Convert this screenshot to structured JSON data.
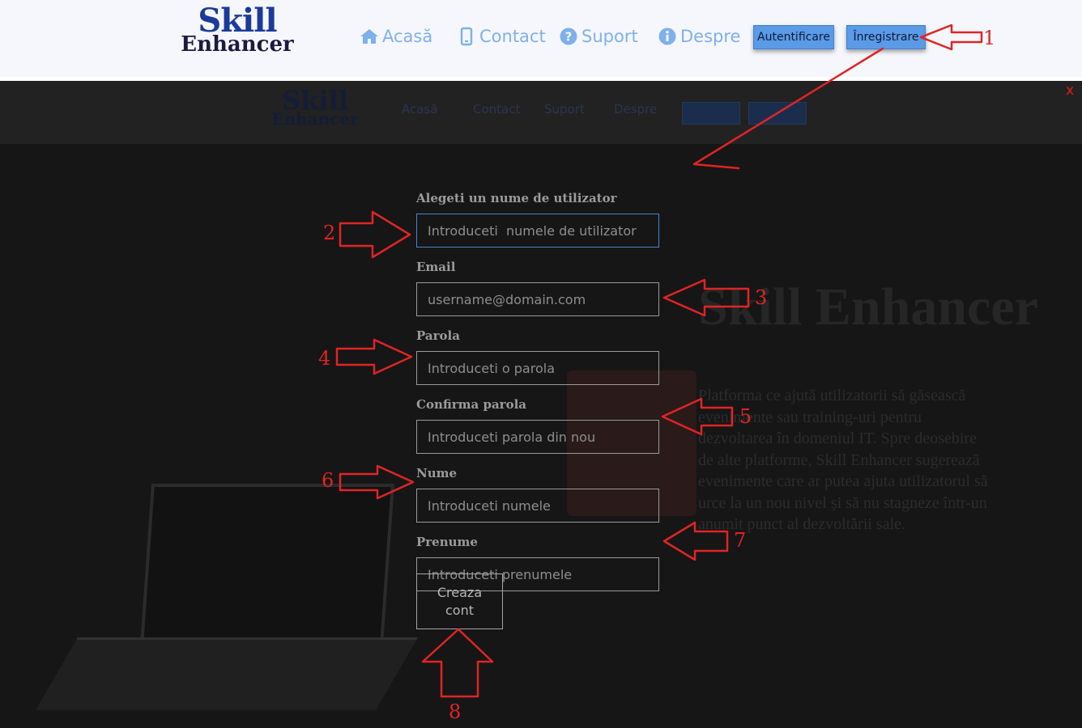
{
  "header": {
    "logo_line1": "Skill",
    "logo_line2": "Enhancer",
    "nav": [
      {
        "label": "Acasă",
        "icon": "home-icon"
      },
      {
        "label": "Contact",
        "icon": "mobile-icon"
      },
      {
        "label": "Suport",
        "icon": "question-circle-icon"
      },
      {
        "label": "Despre",
        "icon": "info-circle-icon"
      }
    ],
    "login_label": "Autentificare",
    "register_label": "Înregistrare"
  },
  "modal": {
    "close_label": "x",
    "hero_title": "Skill Enhancer",
    "hero_text": "Platforma ce ajută utilizatorii să găsească evenimente sau training-uri pentru dezvoltarea în domeniul IT. Spre deosebire de alte platforme, Skill Enhancer sugerează evenimente care ar putea ajuta utilizatorul să urce la un nou nivel și să nu stagneze într-un anumit punct al dezvoltării sale."
  },
  "form": {
    "username_label": "Alegeti un nume de utilizator",
    "username_placeholder": "Introduceti  numele de utilizator",
    "email_label": "Email",
    "email_placeholder": "username@domain.com",
    "password_label": "Parola",
    "password_placeholder": "Introduceti o parola",
    "confirm_label": "Confirma parola",
    "confirm_placeholder": "Introduceti parola din nou",
    "lastname_label": "Nume",
    "lastname_placeholder": "Introduceti numele",
    "firstname_label": "Prenume",
    "firstname_placeholder": "Introduceti prenumele",
    "submit_line1": "Creaza",
    "submit_line2": "cont"
  },
  "annotations": [
    "1",
    "2",
    "3",
    "4",
    "5",
    "6",
    "7",
    "8"
  ],
  "colors": {
    "annotation": "#e02424",
    "nav_link": "#7fb0ec",
    "nav_button": "#5b9ae6",
    "logo_blue": "#1b3a99",
    "modal_bg": "#1c1c1c"
  }
}
